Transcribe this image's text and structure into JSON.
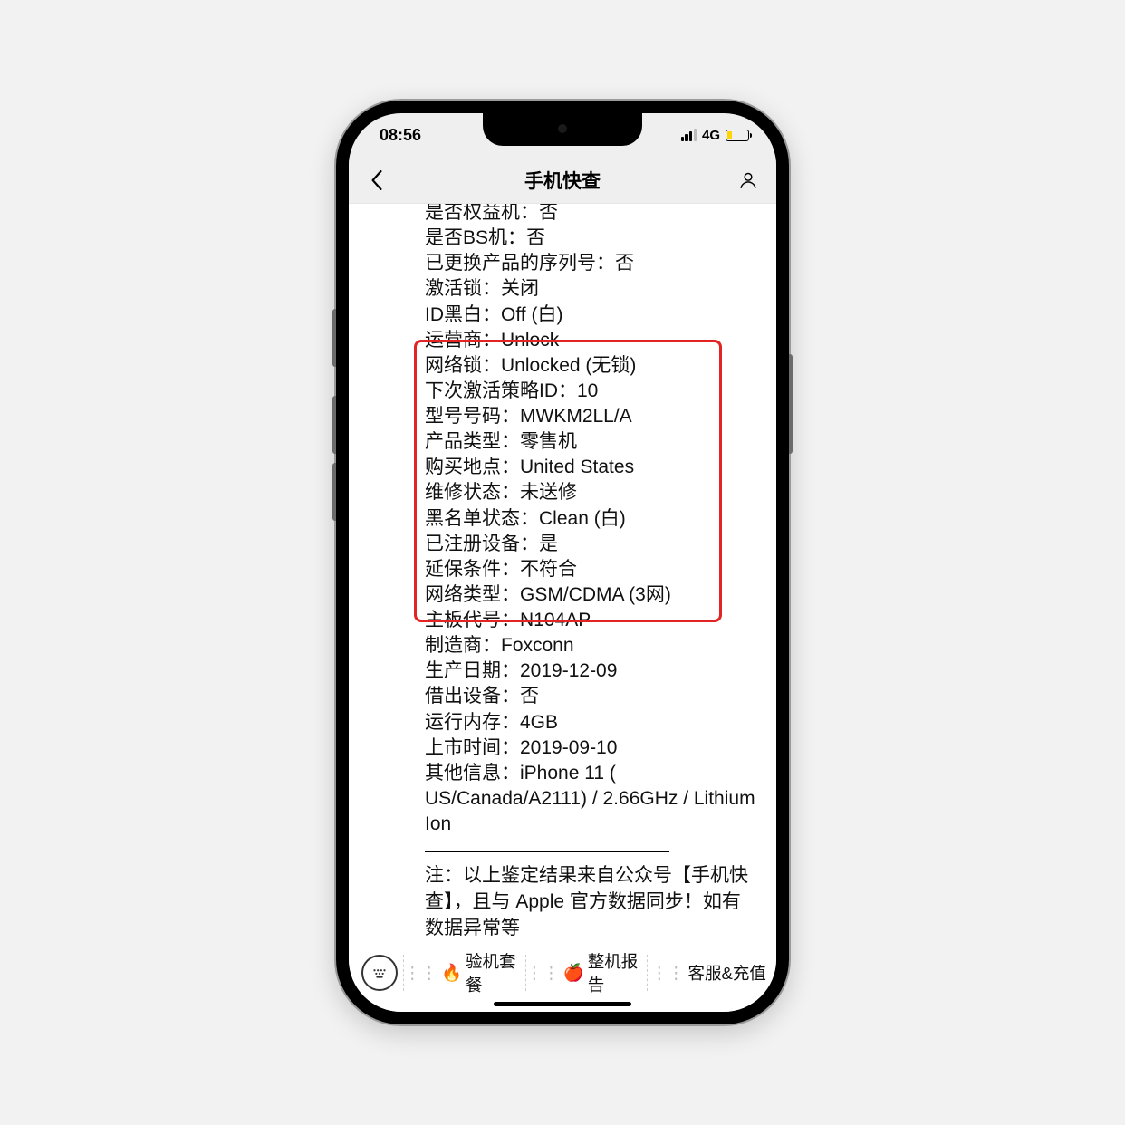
{
  "status": {
    "time": "08:56",
    "network": "4G"
  },
  "navbar": {
    "title": "手机快查"
  },
  "rows": [
    {
      "label": "是否权益机",
      "value": "否"
    },
    {
      "label": "是否BS机",
      "value": "否"
    },
    {
      "label": "已更换产品的序列号",
      "value": "否"
    },
    {
      "label": "激活锁",
      "value": "关闭"
    },
    {
      "label": "ID黑白",
      "value": "Off (白)"
    },
    {
      "label": "运营商",
      "value": "Unlock"
    },
    {
      "label": "网络锁",
      "value": "Unlocked (无锁)"
    },
    {
      "label": "下次激活策略ID",
      "value": "10"
    },
    {
      "label": "型号号码",
      "value": "MWKM2LL/A"
    },
    {
      "label": "产品类型",
      "value": "零售机"
    },
    {
      "label": "购买地点",
      "value": "United States"
    },
    {
      "label": "维修状态",
      "value": "未送修"
    },
    {
      "label": "黑名单状态",
      "value": "Clean (白)"
    },
    {
      "label": "已注册设备",
      "value": "是"
    },
    {
      "label": "延保条件",
      "value": "不符合"
    },
    {
      "label": "网络类型",
      "value": "GSM/CDMA (3网)"
    },
    {
      "label": "主板代号",
      "value": "N104AP"
    },
    {
      "label": "制造商",
      "value": "Foxconn"
    },
    {
      "label": "生产日期",
      "value": "2019-12-09"
    },
    {
      "label": "借出设备",
      "value": "否"
    },
    {
      "label": "运行内存",
      "value": "4GB"
    },
    {
      "label": "上市时间",
      "value": "2019-09-10"
    },
    {
      "label": "其他信息",
      "value": "iPhone 11 ( US/Canada/A2111) / 2.66GHz / Lithium Ion"
    }
  ],
  "note": "注：以上鉴定结果来自公众号【手机快查】，且与 Apple 官方数据同步！如有数据异常等",
  "toolbar": {
    "item1_icon": "🔥",
    "item1_label": "验机套餐",
    "item2_icon": "🍎",
    "item2_label": "整机报告",
    "item3_label": "客服&充值"
  }
}
